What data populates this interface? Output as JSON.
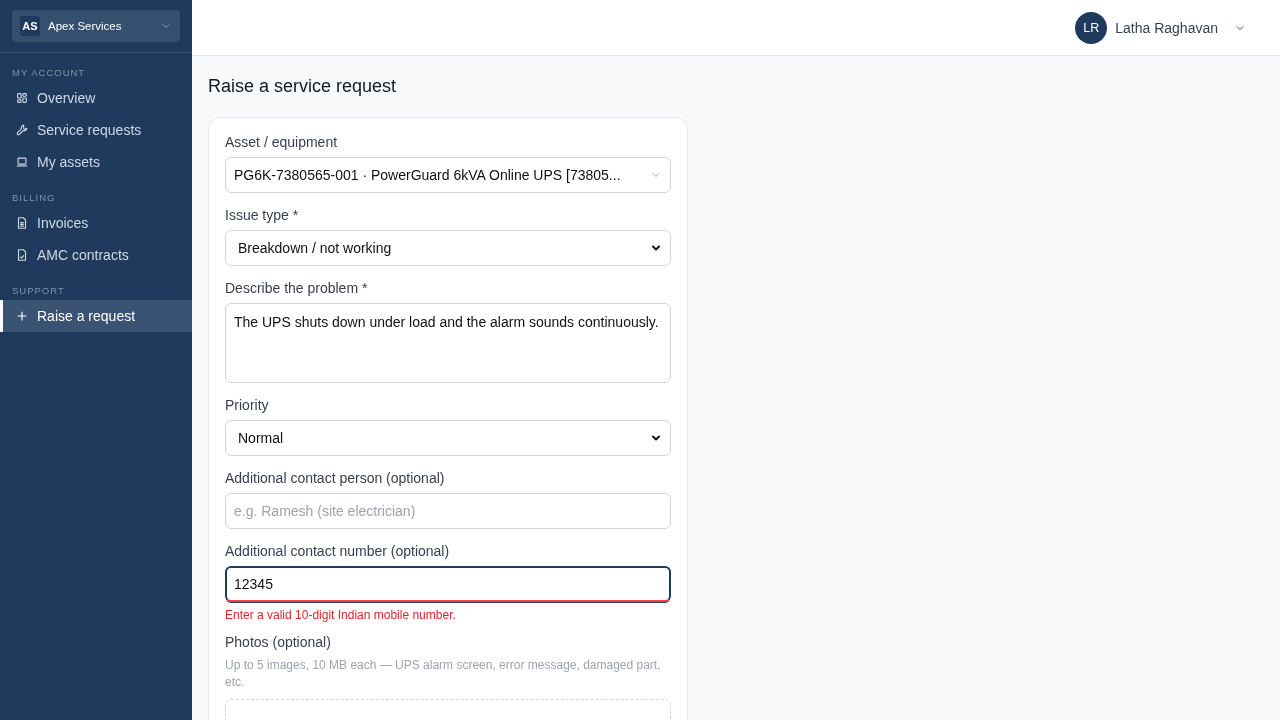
{
  "sidebar": {
    "org": {
      "initials": "AS",
      "name": "Apex Services"
    },
    "sections": [
      {
        "heading": "MY ACCOUNT",
        "items": [
          {
            "label": "Overview",
            "selected": false
          },
          {
            "label": "Service requests",
            "selected": false
          },
          {
            "label": "My assets",
            "selected": false
          }
        ]
      },
      {
        "heading": "BILLING",
        "items": [
          {
            "label": "Invoices",
            "selected": false
          },
          {
            "label": "AMC contracts",
            "selected": false
          }
        ]
      },
      {
        "heading": "SUPPORT",
        "items": [
          {
            "label": "Raise a request",
            "selected": true
          }
        ]
      }
    ]
  },
  "user": {
    "initials": "LR",
    "name": "Latha Raghavan"
  },
  "page_title": "Raise a service request",
  "fields": [
    {
      "kind": "combo",
      "label": "Asset / equipment",
      "value": "PG6K-7380565-001 · PowerGuard 6kVA Online UPS [73805..."
    },
    {
      "kind": "select",
      "label": "Issue type *",
      "value": "Breakdown / not working"
    },
    {
      "kind": "textarea",
      "label": "Describe the problem *",
      "value": "The UPS shuts down under load and the alarm sounds continuously."
    },
    {
      "kind": "select",
      "label": "Priority",
      "value": "Normal"
    },
    {
      "kind": "input",
      "label": "Additional contact person (optional)",
      "placeholder": "e.g. Ramesh (site electrician)",
      "focused": false,
      "invalid": false
    },
    {
      "kind": "input",
      "label": "Additional contact number (optional)",
      "value": "12345",
      "focused": true,
      "invalid": true,
      "error": "Enter a valid 10-digit Indian mobile number."
    },
    {
      "kind": "upload",
      "label": "Photos (optional)",
      "hint": "Up to 5 images, 10 MB each — UPS alarm screen, error message, damaged part, etc."
    }
  ]
}
